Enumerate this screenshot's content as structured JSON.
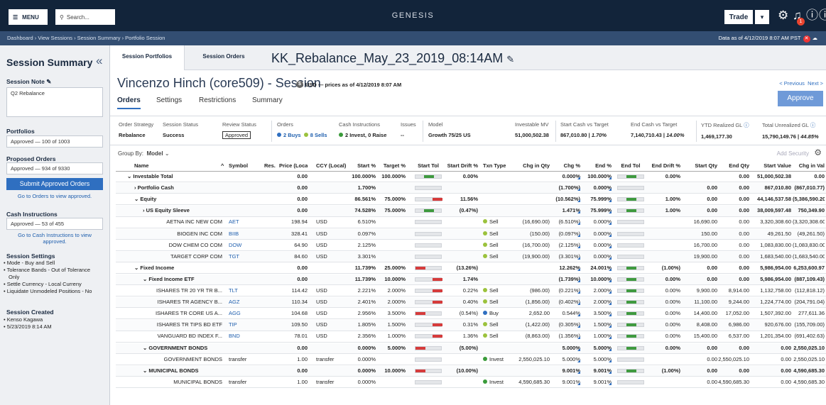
{
  "topbar": {
    "menu": "MENU",
    "search_placeholder": "Search...",
    "brand": "GENESIS",
    "trade": "Trade",
    "notif_count": "1"
  },
  "breadcrumb": {
    "path": "Dashboard › View Sessions › Session Summary › Portfolio Session",
    "as_of": "Data as of 4/12/2019 8:07 AM PST"
  },
  "sidebar": {
    "title": "Session Summary",
    "note_label": "Session Note",
    "note_value": "Q2 Rebalance",
    "portfolios_label": "Portfolios",
    "portfolios_value": "Approved — 100 of 1003",
    "proposed_label": "Proposed Orders",
    "proposed_value": "Approved — 934 of 9330",
    "submit": "Submit Approved Orders",
    "orders_link": "Go to Orders to view approved.",
    "cash_label": "Cash Instructions",
    "cash_value": "Approved — 53 of 455",
    "cash_link": "Go to Cash Instructions to view approved.",
    "settings_label": "Session Settings",
    "settings": [
      "• Mode - Buy and Sell",
      "• Tolerance Bands - Out of Tolerance",
      "  Only",
      "• Settle Currency - Local Curreny",
      "• Liquidate Unmodeled Positions - No"
    ],
    "created_label": "Session Created",
    "created": [
      "• Kenso Kagawa",
      "• 5/23/2019 8:14 AM"
    ]
  },
  "tabs": {
    "portfolios": "Session Portfolios",
    "orders": "Session Orders",
    "session_name": "KK_Rebalance_May_23_2019_08:14AM"
  },
  "client": {
    "name": "Vincenzo Hinch (core509) - Session",
    "currency": "USD — prices as of 4/12/2019 8:07 AM",
    "prev": "< Previous",
    "next": "Next >"
  },
  "subtabs": [
    "Orders",
    "Settings",
    "Restrictions",
    "Summary"
  ],
  "approve": "Approve",
  "summary": {
    "order_strategy": {
      "label": "Order Strategy",
      "value": "Rebalance"
    },
    "session_status": {
      "label": "Session Status",
      "value": "Success"
    },
    "review_status": {
      "label": "Review Status",
      "value": "Approved"
    },
    "orders": {
      "label": "Orders",
      "buys": "2 Buys",
      "sells": "8 Sells"
    },
    "cash": {
      "label": "Cash Instructions",
      "value": "2 Invest, 0 Raise"
    },
    "issues": {
      "label": "Issues",
      "value": "--"
    },
    "model": {
      "label": "Model",
      "value": "Growth 75/25 US"
    },
    "investable": {
      "label": "Investable MV",
      "value": "51,000,502.38"
    },
    "start_cash": {
      "label": "Start Cash vs Target",
      "value": "867,010.80 |",
      "pct": "1.70%"
    },
    "end_cash": {
      "label": "End Cash vs Target",
      "value": "7,140,710.43 |",
      "pct": "14.00%"
    },
    "ytd": {
      "label": "YTD Realized GL",
      "value": "1,469,177.30"
    },
    "unreal": {
      "label": "Total Unrealized GL",
      "value": "15,790,149.76 |",
      "pct": "44.85%"
    }
  },
  "groupby": {
    "label": "Group By:",
    "value": "Model"
  },
  "addsec": "Add Security",
  "columns": [
    "Name",
    "Symbol",
    "Res.",
    "Price (Local)",
    "CCY (Local)",
    "Start %",
    "Target %",
    "Start Tol",
    "Start Drift %",
    "Txn Type",
    "Chg in Qty",
    "Chg %",
    "End %",
    "End Tol",
    "End Drift %",
    "Start Qty",
    "End Qty",
    "Start Value",
    "Chg in Val"
  ],
  "rows": [
    {
      "name": "Investable Total",
      "lvl": 1,
      "ind": "⌄",
      "bold": true,
      "sym": "",
      "price": "0.00",
      "ccy": "",
      "start": "100.000%",
      "target": "100.000%",
      "stol": "g",
      "sdrift": "0.00%",
      "txn": "",
      "dot": "",
      "chq": "",
      "chg": "0.000%",
      "end": "100.000%",
      "etol": "g",
      "edrift": "0.00%",
      "sq": "",
      "eq": "0.00",
      "sv": "51,000,502.38",
      "cv": "0.00"
    },
    {
      "name": "Portfolio Cash",
      "lvl": 2,
      "ind": "›",
      "bold": true,
      "sym": "",
      "price": "0.00",
      "ccy": "",
      "start": "1.700%",
      "target": "",
      "stol": "e",
      "sdrift": "",
      "txn": "",
      "dot": "",
      "chq": "",
      "chg": "(1.700%)",
      "end": "0.000%",
      "etol": "e",
      "edrift": "",
      "sq": "0.00",
      "eq": "0.00",
      "sv": "867,010.80",
      "cv": "(867,010.77)"
    },
    {
      "name": "Equity",
      "lvl": 2,
      "ind": "⌄",
      "bold": true,
      "sym": "",
      "price": "0.00",
      "ccy": "",
      "start": "86.561%",
      "target": "75.000%",
      "stol": "r",
      "sdrift": "11.56%",
      "txn": "",
      "dot": "",
      "chq": "",
      "chg": "(10.562%)",
      "end": "75.999%",
      "etol": "g",
      "edrift": "1.00%",
      "sq": "0.00",
      "eq": "0.00",
      "sv": "44,146,537.58",
      "cv": "(5,386,590.20)"
    },
    {
      "name": "US Equity Sleeve",
      "lvl": 3,
      "ind": "›",
      "bold": true,
      "sym": "",
      "price": "0.00",
      "ccy": "",
      "start": "74.528%",
      "target": "75.000%",
      "stol": "g",
      "sdrift": "(0.47%)",
      "txn": "",
      "dot": "",
      "chq": "",
      "chg": "1.471%",
      "end": "75.999%",
      "etol": "g",
      "edrift": "1.00%",
      "sq": "0.00",
      "eq": "0.00",
      "sv": "38,009,597.48",
      "cv": "750,349.90"
    },
    {
      "name": "AETNA INC NEW COM",
      "lvl": 4,
      "ind": "",
      "bold": false,
      "sym": "AET",
      "price": "198.94",
      "ccy": "USD",
      "start": "6.510%",
      "target": "",
      "stol": "e",
      "sdrift": "",
      "txn": "Sell",
      "dot": "g",
      "chq": "(16,690.00)",
      "chg": "(6.510%)",
      "end": "0.000%",
      "etol": "e",
      "edrift": "",
      "sq": "16,690.00",
      "eq": "0.00",
      "sv": "3,320,308.60",
      "cv": "(3,320,308.60)"
    },
    {
      "name": "BIOGEN INC COM",
      "lvl": 4,
      "ind": "",
      "bold": false,
      "sym": "BIIB",
      "price": "328.41",
      "ccy": "USD",
      "start": "0.097%",
      "target": "",
      "stol": "e",
      "sdrift": "",
      "txn": "Sell",
      "dot": "g",
      "chq": "(150.00)",
      "chg": "(0.097%)",
      "end": "0.000%",
      "etol": "e",
      "edrift": "",
      "sq": "150.00",
      "eq": "0.00",
      "sv": "49,261.50",
      "cv": "(49,261.50)"
    },
    {
      "name": "DOW CHEM CO COM",
      "lvl": 4,
      "ind": "",
      "bold": false,
      "sym": "DOW",
      "price": "64.90",
      "ccy": "USD",
      "start": "2.125%",
      "target": "",
      "stol": "e",
      "sdrift": "",
      "txn": "Sell",
      "dot": "g",
      "chq": "(16,700.00)",
      "chg": "(2.125%)",
      "end": "0.000%",
      "etol": "e",
      "edrift": "",
      "sq": "16,700.00",
      "eq": "0.00",
      "sv": "1,083,830.00",
      "cv": "(1,083,830.00)"
    },
    {
      "name": "TARGET CORP COM",
      "lvl": 4,
      "ind": "",
      "bold": false,
      "sym": "TGT",
      "price": "84.60",
      "ccy": "USD",
      "start": "3.301%",
      "target": "",
      "stol": "e",
      "sdrift": "",
      "txn": "Sell",
      "dot": "g",
      "chq": "(19,900.00)",
      "chg": "(3.301%)",
      "end": "0.000%",
      "etol": "e",
      "edrift": "",
      "sq": "19,900.00",
      "eq": "0.00",
      "sv": "1,683,540.00",
      "cv": "(1,683,540.00)"
    },
    {
      "name": "Fixed Income",
      "lvl": 2,
      "ind": "⌄",
      "bold": true,
      "sym": "",
      "price": "0.00",
      "ccy": "",
      "start": "11.739%",
      "target": "25.000%",
      "stol": "rl",
      "sdrift": "(13.26%)",
      "txn": "",
      "dot": "",
      "chq": "",
      "chg": "12.262%",
      "end": "24.001%",
      "etol": "g",
      "edrift": "(1.00%)",
      "sq": "0.00",
      "eq": "0.00",
      "sv": "5,986,954.00",
      "cv": "6,253,600.97"
    },
    {
      "name": "Fixed Income ETF",
      "lvl": 3,
      "ind": "⌄",
      "bold": true,
      "sym": "",
      "price": "0.00",
      "ccy": "",
      "start": "11.739%",
      "target": "10.000%",
      "stol": "r",
      "sdrift": "1.74%",
      "txn": "",
      "dot": "",
      "chq": "",
      "chg": "(1.739%)",
      "end": "10.000%",
      "etol": "g",
      "edrift": "0.00%",
      "sq": "0.00",
      "eq": "0.00",
      "sv": "5,986,954.00",
      "cv": "(887,109.43)"
    },
    {
      "name": "ISHARES TR 20 YR TR B...",
      "lvl": 4,
      "ind": "",
      "bold": false,
      "sym": "TLT",
      "price": "114.42",
      "ccy": "USD",
      "start": "2.221%",
      "target": "2.000%",
      "stol": "r",
      "sdrift": "0.22%",
      "txn": "Sell",
      "dot": "g",
      "chq": "(986.00)",
      "chg": "(0.221%)",
      "end": "2.000%",
      "etol": "g",
      "edrift": "0.00%",
      "sq": "9,900.00",
      "eq": "8,914.00",
      "sv": "1,132,758.00",
      "cv": "(112,818.12)"
    },
    {
      "name": "ISHARES TR AGENCY B...",
      "lvl": 4,
      "ind": "",
      "bold": false,
      "sym": "AGZ",
      "price": "110.34",
      "ccy": "USD",
      "start": "2.401%",
      "target": "2.000%",
      "stol": "r",
      "sdrift": "0.40%",
      "txn": "Sell",
      "dot": "g",
      "chq": "(1,856.00)",
      "chg": "(0.402%)",
      "end": "2.000%",
      "etol": "g",
      "edrift": "0.00%",
      "sq": "11,100.00",
      "eq": "9,244.00",
      "sv": "1,224,774.00",
      "cv": "(204,791.04)"
    },
    {
      "name": "ISHARES TR CORE US A...",
      "lvl": 4,
      "ind": "",
      "bold": false,
      "sym": "AGG",
      "price": "104.68",
      "ccy": "USD",
      "start": "2.956%",
      "target": "3.500%",
      "stol": "rl",
      "sdrift": "(0.54%)",
      "txn": "Buy",
      "dot": "b",
      "chq": "2,652.00",
      "chg": "0.544%",
      "end": "3.500%",
      "etol": "g",
      "edrift": "0.00%",
      "sq": "14,400.00",
      "eq": "17,052.00",
      "sv": "1,507,392.00",
      "cv": "277,611.36"
    },
    {
      "name": "ISHARES TR TIPS BD ETF",
      "lvl": 4,
      "ind": "",
      "bold": false,
      "sym": "TIP",
      "price": "109.50",
      "ccy": "USD",
      "start": "1.805%",
      "target": "1.500%",
      "stol": "r",
      "sdrift": "0.31%",
      "txn": "Sell",
      "dot": "g",
      "chq": "(1,422.00)",
      "chg": "(0.305%)",
      "end": "1.500%",
      "etol": "g",
      "edrift": "0.00%",
      "sq": "8,408.00",
      "eq": "6,986.00",
      "sv": "920,676.00",
      "cv": "(155,709.00)"
    },
    {
      "name": "VANGUARD BD INDEX F...",
      "lvl": 4,
      "ind": "",
      "bold": false,
      "sym": "BND",
      "price": "78.01",
      "ccy": "USD",
      "start": "2.356%",
      "target": "1.000%",
      "stol": "r",
      "sdrift": "1.36%",
      "txn": "Sell",
      "dot": "g",
      "chq": "(8,863.00)",
      "chg": "(1.356%)",
      "end": "1.000%",
      "etol": "g",
      "edrift": "0.00%",
      "sq": "15,400.00",
      "eq": "6,537.00",
      "sv": "1,201,354.00",
      "cv": "(691,402.63)"
    },
    {
      "name": "GOVERNMENT BONDS",
      "lvl": 3,
      "ind": "⌄",
      "bold": true,
      "sym": "",
      "price": "0.00",
      "ccy": "",
      "start": "0.000%",
      "target": "5.000%",
      "stol": "rl",
      "sdrift": "(5.00%)",
      "txn": "",
      "dot": "",
      "chq": "",
      "chg": "5.000%",
      "end": "5.000%",
      "etol": "g",
      "edrift": "0.00%",
      "sq": "0.00",
      "eq": "0.00",
      "sv": "0.00",
      "cv": "2,550,025.10"
    },
    {
      "name": "GOVERNMENT BONDS",
      "lvl": 4,
      "ind": "",
      "bold": false,
      "sym": "transfer",
      "price": "1.00",
      "ccy": "transfer",
      "start": "0.000%",
      "target": "",
      "stol": "e",
      "sdrift": "",
      "txn": "Invest",
      "dot": "gr",
      "chq": "2,550,025.10",
      "chg": "5.000%",
      "end": "5.000%",
      "etol": "e",
      "edrift": "",
      "sq": "0.00",
      "eq": "2,550,025.10",
      "sv": "0.00",
      "cv": "2,550,025.10"
    },
    {
      "name": "MUNICIPAL BONDS",
      "lvl": 3,
      "ind": "⌄",
      "bold": true,
      "sym": "",
      "price": "0.00",
      "ccy": "",
      "start": "0.000%",
      "target": "10.000%",
      "stol": "rl",
      "sdrift": "(10.00%)",
      "txn": "",
      "dot": "",
      "chq": "",
      "chg": "9.001%",
      "end": "9.001%",
      "etol": "g",
      "edrift": "(1.00%)",
      "sq": "0.00",
      "eq": "0.00",
      "sv": "0.00",
      "cv": "4,590,685.30"
    },
    {
      "name": "MUNICIPAL BONDS",
      "lvl": 4,
      "ind": "",
      "bold": false,
      "sym": "transfer",
      "price": "1.00",
      "ccy": "transfer",
      "start": "0.000%",
      "target": "",
      "stol": "e",
      "sdrift": "",
      "txn": "Invest",
      "dot": "gr",
      "chq": "4,590,685.30",
      "chg": "9.001%",
      "end": "9.001%",
      "etol": "e",
      "edrift": "",
      "sq": "0.00",
      "eq": "4,590,685.30",
      "sv": "0.00",
      "cv": "4,590,685.30"
    }
  ]
}
